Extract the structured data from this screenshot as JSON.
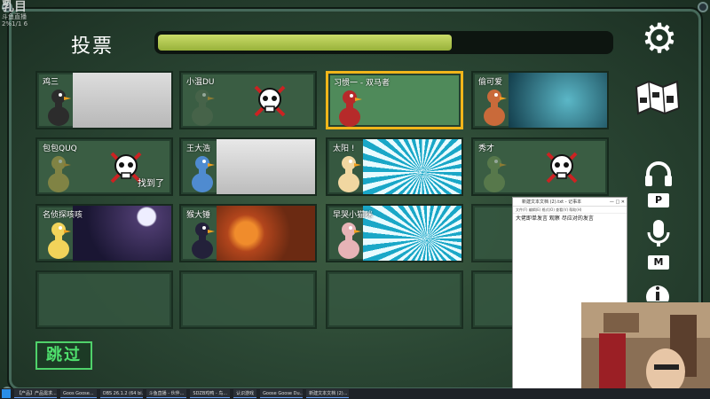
{
  "watermark": {
    "big": "乳目",
    "line1": "斗鱼直播",
    "line2": "2%1/1 6"
  },
  "header": {
    "title": "投票",
    "timer_remaining": 0.65
  },
  "colors": {
    "accent": "#f1b51a",
    "skip": "#4fe06d",
    "timer": "#b3c94f"
  },
  "icons": {
    "settings": "gear-icon",
    "map": "map-icon",
    "voice": "headphones-icon",
    "mic": "microphone-icon"
  },
  "keys": {
    "voice": "P",
    "mic": "M"
  },
  "players": [
    {
      "name": "鸡三",
      "status": "alive"
    },
    {
      "name": "小温DU",
      "status": "dead"
    },
    {
      "name": "习惯一 - 双马者",
      "status": "alive",
      "selected": true
    },
    {
      "name": "偷可爱",
      "status": "alive"
    },
    {
      "name": "包包QUQ",
      "status": "dead",
      "found": "找到了"
    },
    {
      "name": "王大浩",
      "status": "alive"
    },
    {
      "name": "太阳 !",
      "status": "alive"
    },
    {
      "name": "秀才",
      "status": "dead"
    },
    {
      "name": "名侦探咳咳",
      "status": "alive"
    },
    {
      "name": "猴大锤",
      "status": "alive"
    },
    {
      "name": "早哭小猫咪",
      "status": "alive"
    }
  ],
  "skip_label": "跳过",
  "notepad": {
    "title": "新建文本文档 (2).txt - 记事本",
    "controls": "— □ ✕",
    "menu": "文件(F)  编辑(E)  格式(O)  查看(V)  帮助(H)",
    "text": "大佬即单发言 观察 尽应对的发言"
  },
  "taskbar": [
    {
      "label": ""
    },
    {
      "label": "【产品】产品需求..."
    },
    {
      "label": "Goos Goose..."
    },
    {
      "label": "OBS 26.1.2 (64 bi..."
    },
    {
      "label": "斗鱼直播 - 伙伴..."
    },
    {
      "label": "SDZB鸡鸭 - 鸟..."
    },
    {
      "label": "认识游戏"
    },
    {
      "label": "Goose Goose Du..."
    },
    {
      "label": "新建文本文档 (2)..."
    }
  ]
}
